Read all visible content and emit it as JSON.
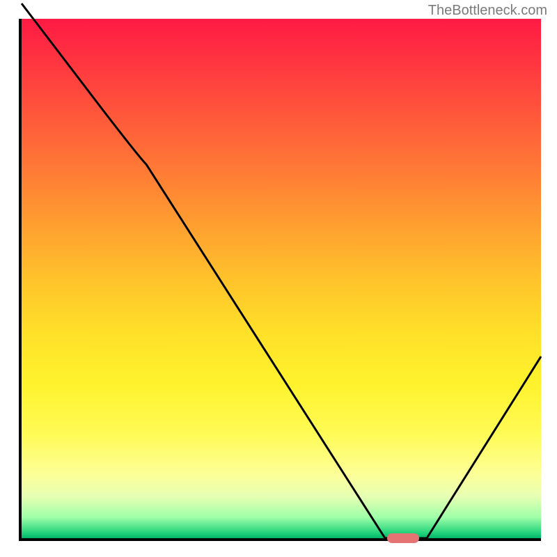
{
  "watermark": "TheBottleneck.com",
  "chart_data": {
    "type": "line",
    "title": "",
    "xlabel": "",
    "ylabel": "",
    "xlim": [
      0,
      100
    ],
    "ylim": [
      0,
      100
    ],
    "x": [
      0,
      16,
      24,
      70,
      78,
      100
    ],
    "values": [
      103,
      82,
      72,
      0,
      0,
      35
    ],
    "valley_marker": {
      "x": 74,
      "width": 6
    },
    "gradient": [
      "#ff1a44",
      "#ff7d35",
      "#ffdf29",
      "#fcff9a",
      "#22d27a"
    ],
    "series": [
      {
        "name": "bottleneck-curve",
        "x": [
          0,
          16,
          24,
          70,
          78,
          100
        ],
        "values": [
          103,
          82,
          72,
          0,
          0,
          35
        ]
      }
    ]
  }
}
